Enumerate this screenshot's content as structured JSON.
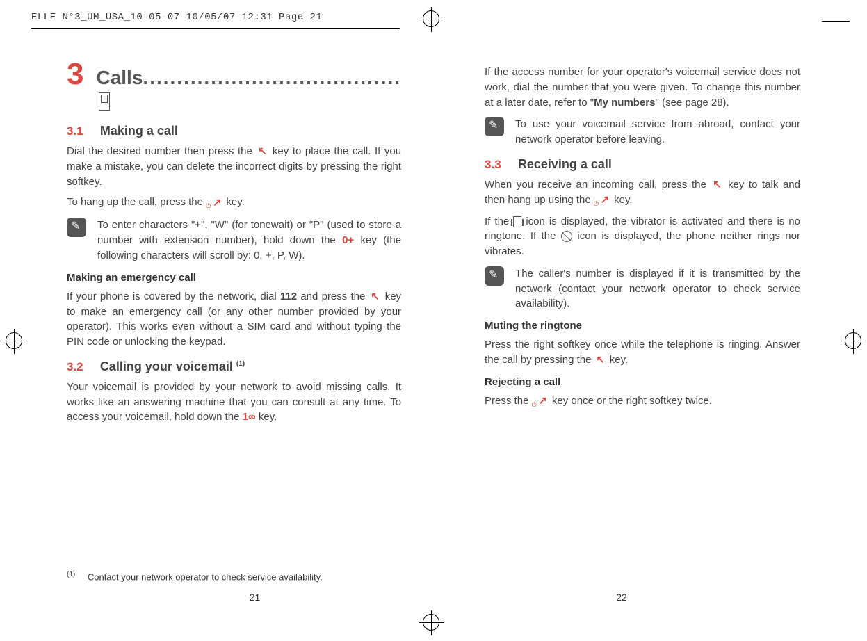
{
  "crop_header": "ELLE N°3_UM_USA_10-05-07  10/05/07  12:31  Page 21",
  "chapter": {
    "num": "3",
    "title": "Calls",
    "dots": "......................................"
  },
  "s31": {
    "num": "3.1",
    "title": "Making a call",
    "p1a": "Dial the desired number then press the ",
    "p1b": " key to place the call. If you make a mistake, you can delete the incorrect digits by pressing the right softkey.",
    "p2a": "To hang up the call, press the ",
    "p2b": " key.",
    "tip_a": "To enter characters \"+\", \"W\" (for tonewait) or \"P\" (used to store a number with extension number), hold down the ",
    "tip_b": " key (the following characters will scroll by: 0, +, P, W).",
    "sub1": "Making an emergency call",
    "p3a": "If your phone is covered by the network, dial ",
    "p3b": "112",
    "p3c": " and press the ",
    "p3d": " key to make an emergency call (or any other number provided by your operator). This works even without a SIM card and without typing the PIN code or unlocking the keypad."
  },
  "s32": {
    "num": "3.2",
    "title": "Calling your voicemail ",
    "sup": "(1)",
    "p1a": "Your voicemail is provided by your network to avoid missing calls. It works like an answering machine that you can consult at any time. To access your voicemail, hold down the ",
    "p1b": " key."
  },
  "footnote": {
    "sup": "(1)",
    "text": "Contact your network operator to check service availability."
  },
  "page_left": "21",
  "right_intro_a": "If the access number for your operator's voicemail service does not work, dial the number that you were given. To change this number at a later date, refer to \"",
  "right_intro_b": "My numbers",
  "right_intro_c": "\" (see page 28).",
  "right_tip1": "To use your voicemail service from abroad, contact your network operator before leaving.",
  "s33": {
    "num": "3.3",
    "title": "Receiving a call",
    "p1a": "When you receive an incoming call, press the ",
    "p1b": " key to talk and then hang up using the ",
    "p1c": " key.",
    "p2a": "If the ",
    "p2b": " icon is displayed, the vibrator is activated and there is no ringtone. If the ",
    "p2c": " icon is displayed, the phone neither rings nor vibrates.",
    "tip": "The caller's number is displayed if it is transmitted by the network (contact your network operator to check service availability).",
    "sub1": "Muting the ringtone",
    "p3a": "Press the right softkey once while the telephone is ringing. Answer the call by pressing the ",
    "p3b": " key.",
    "sub2": "Rejecting a call",
    "p4a": "Press the ",
    "p4b": " key once or the right softkey twice."
  },
  "page_right": "22",
  "keys": {
    "zero": "0+",
    "one": "1∞"
  }
}
